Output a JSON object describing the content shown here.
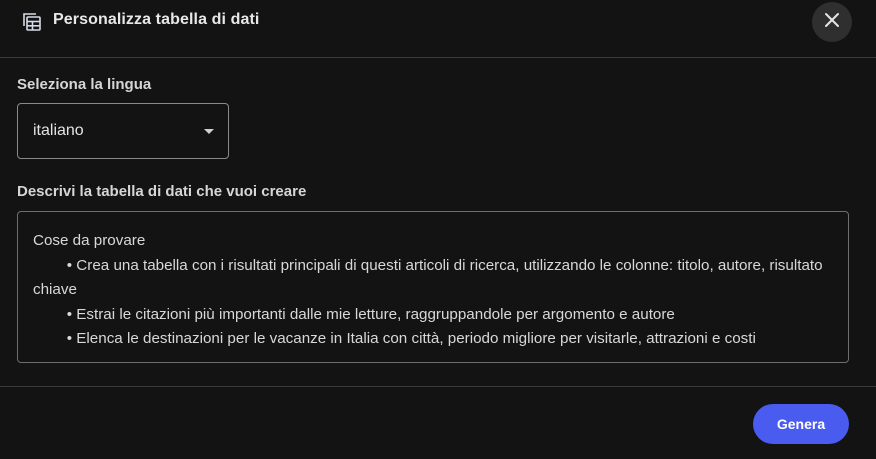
{
  "header": {
    "icon": "table-icon",
    "title": "Personalizza tabella di dati",
    "close_icon": "close-icon"
  },
  "language": {
    "label": "Seleziona la lingua",
    "selected": "italiano",
    "dropdown_icon": "caret-down-icon"
  },
  "description": {
    "label": "Descrivi la tabella di dati che vuoi creare",
    "value": "Cose da provare\n        • Crea una tabella con i risultati principali di questi articoli di ricerca, utilizzando le colonne: titolo, autore, risultato chiave\n        • Estrai le citazioni più importanti dalle mie letture, raggruppandole per argomento e autore\n        • Elenca le destinazioni per le vacanze in Italia con città, periodo migliore per visitarle, attrazioni e costi"
  },
  "footer": {
    "generate_label": "Genera"
  },
  "colors": {
    "background": "#131313",
    "primary_button": "#4a5cf0",
    "close_button_bg": "#2f2f2f",
    "border": "#8a8a8a"
  }
}
